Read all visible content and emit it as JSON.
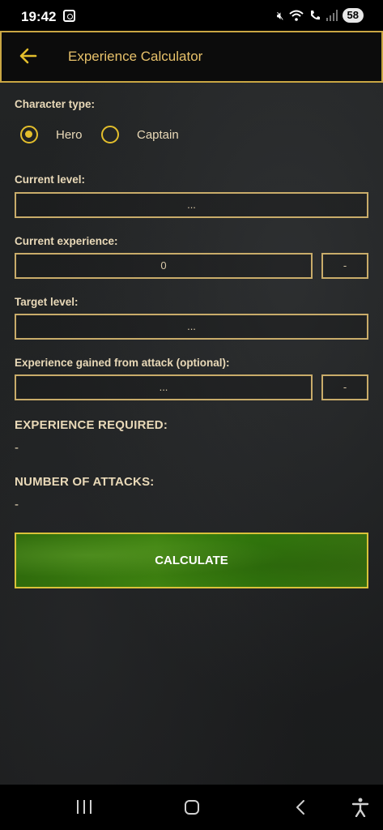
{
  "status": {
    "time": "19:42",
    "battery": "58",
    "icons": [
      "screenshot-icon",
      "mute-icon",
      "wifi-icon",
      "wifi-call-icon",
      "signal-icon"
    ]
  },
  "header": {
    "title": "Experience Calculator",
    "back_icon": "arrow-left-icon"
  },
  "form": {
    "character_type_label": "Character type:",
    "options": [
      {
        "label": "Hero",
        "selected": true
      },
      {
        "label": "Captain",
        "selected": false
      }
    ],
    "current_level_label": "Current level:",
    "current_level_placeholder": "...",
    "current_experience_label": "Current experience:",
    "current_experience_value": "0",
    "current_experience_unit": "-",
    "target_level_label": "Target level:",
    "target_level_placeholder": "...",
    "attack_xp_label": "Experience gained from attack (optional):",
    "attack_xp_placeholder": "...",
    "attack_xp_unit": "-"
  },
  "results": {
    "experience_required_heading": "EXPERIENCE REQUIRED:",
    "experience_required_value": "-",
    "attacks_heading": "NUMBER OF ATTACKS:",
    "attacks_value": "-"
  },
  "actions": {
    "calculate_label": "CALCULATE"
  },
  "colors": {
    "accent_gold": "#e3be2c",
    "title_gold": "#e7c16a",
    "button_green": "#3e8210"
  }
}
